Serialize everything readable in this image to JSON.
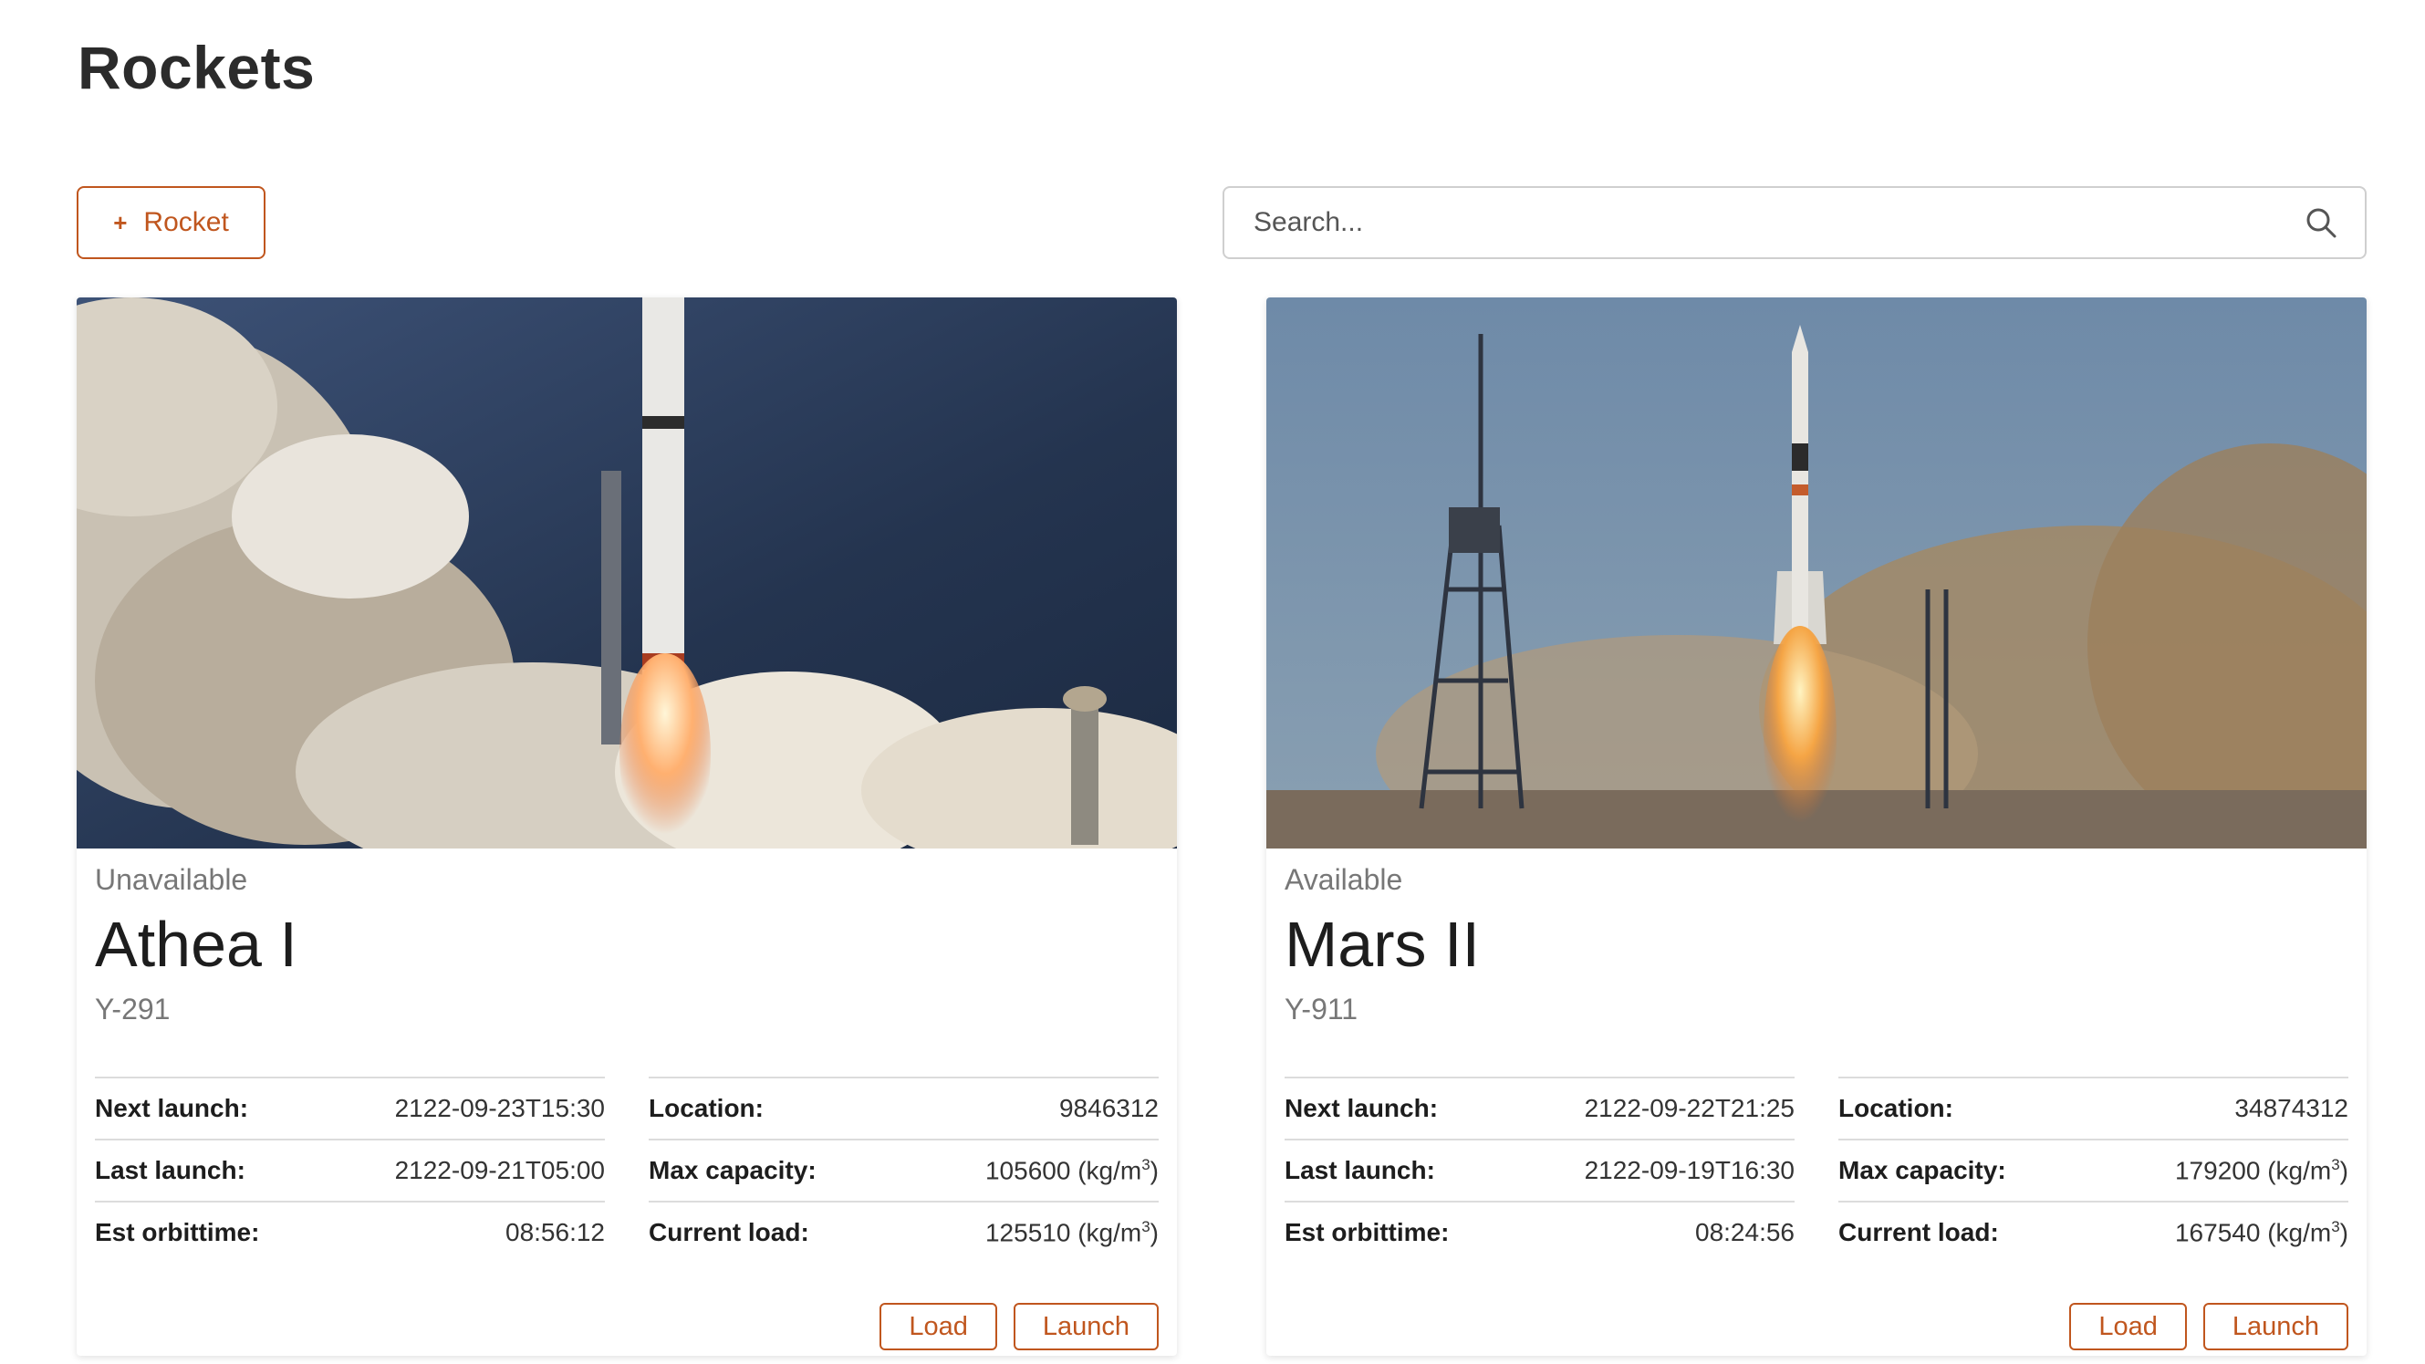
{
  "page": {
    "title": "Rockets"
  },
  "toolbar": {
    "add_button_label": "Rocket",
    "add_icon": "plus-icon"
  },
  "search": {
    "placeholder": "Search...",
    "icon": "search-icon"
  },
  "colors": {
    "accent": "#c0561e",
    "border": "#cfcfcf"
  },
  "rockets": [
    {
      "status": "Unavailable",
      "name": "Athea I",
      "code": "Y-291",
      "specs": {
        "next_launch_label": "Next launch:",
        "next_launch": "2122-09-23T15:30",
        "last_launch_label": "Last launch:",
        "last_launch": "2122-09-21T05:00",
        "orbittime_label": "Est orbittime:",
        "orbittime": "08:56:12",
        "location_label": "Location:",
        "location": "9846312",
        "max_capacity_label": "Max capacity:",
        "max_capacity": "105600 (kg/m",
        "current_load_label": "Current load:",
        "current_load": "125510 (kg/m"
      },
      "load_label": "Load",
      "launch_label": "Launch"
    },
    {
      "status": "Available",
      "name": "Mars II",
      "code": "Y-911",
      "specs": {
        "next_launch_label": "Next launch:",
        "next_launch": "2122-09-22T21:25",
        "last_launch_label": "Last launch:",
        "last_launch": "2122-09-19T16:30",
        "orbittime_label": "Est orbittime:",
        "orbittime": "08:24:56",
        "location_label": "Location:",
        "location": "34874312",
        "max_capacity_label": "Max capacity:",
        "max_capacity": "179200 (kg/m",
        "current_load_label": "Current load:",
        "current_load": "167540 (kg/m"
      },
      "load_label": "Load",
      "launch_label": "Launch"
    }
  ],
  "unit_suffix": {
    "exponent": "3",
    "close": ")"
  }
}
